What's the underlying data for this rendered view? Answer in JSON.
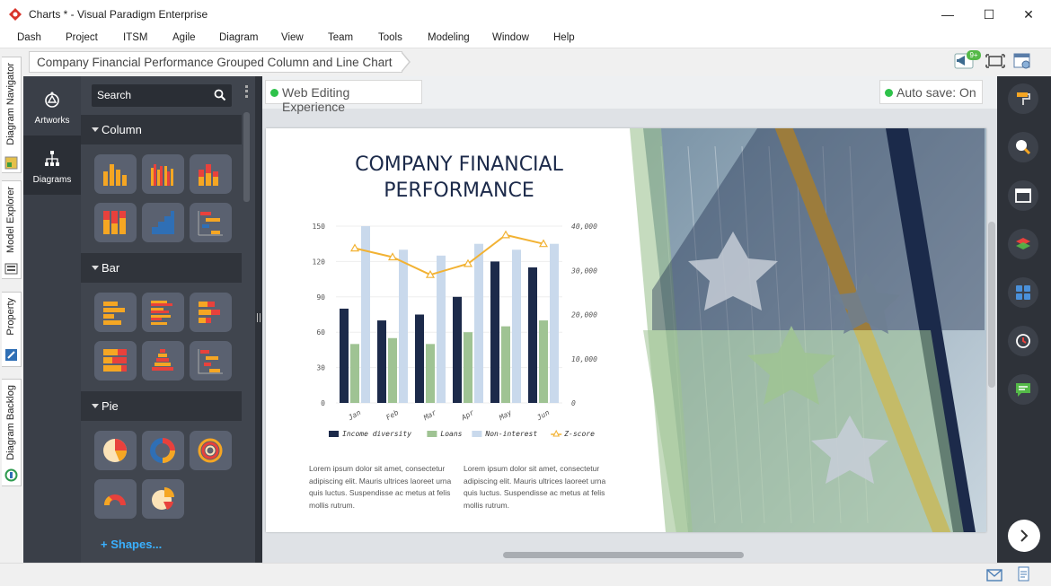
{
  "window": {
    "title": "Charts * - Visual Paradigm Enterprise",
    "minimize": "—",
    "maximize": "☐",
    "close": "✕"
  },
  "menu": [
    "Dash",
    "Project",
    "ITSM",
    "Agile",
    "Diagram",
    "View",
    "Team",
    "Tools",
    "Modeling",
    "Window",
    "Help"
  ],
  "breadcrumb": "Company Financial Performance Grouped Column and Line Chart",
  "notification_badge": "9+",
  "left_tabs": [
    "Diagram Navigator",
    "Model Explorer",
    "Property",
    "Diagram Backlog"
  ],
  "nav": {
    "artworks": "Artworks",
    "diagrams": "Diagrams"
  },
  "palette": {
    "search_placeholder": "Search",
    "sections": [
      "Column",
      "Bar",
      "Pie"
    ],
    "shapes_link": "+ Shapes..."
  },
  "canvas": {
    "web_editing": "Web Editing Experience",
    "autosave": "Auto save: On"
  },
  "slide": {
    "title_line1": "COMPANY FINANCIAL",
    "title_line2": "PERFORMANCE",
    "lorem1": "Lorem ipsum dolor sit amet, consectetur adipiscing elit. Mauris ultrices laoreet urna quis luctus. Suspendisse ac metus at felis mollis rutrum.",
    "lorem2": "Lorem ipsum dolor sit amet, consectetur adipiscing elit. Mauris ultrices laoreet urna quis luctus. Suspendisse ac metus at felis mollis rutrum."
  },
  "chart_data": {
    "type": "bar",
    "categories": [
      "Jan",
      "Feb",
      "Mar",
      "Apr",
      "May",
      "Jun"
    ],
    "series": [
      {
        "name": "Income diversity",
        "type": "bar",
        "axis": "left",
        "values": [
          80,
          70,
          75,
          90,
          120,
          115
        ],
        "color": "#1c2a4a"
      },
      {
        "name": "Loans",
        "type": "bar",
        "axis": "left",
        "values": [
          50,
          55,
          50,
          60,
          65,
          70
        ],
        "color": "#9fc393"
      },
      {
        "name": "Non-interest",
        "type": "bar",
        "axis": "left",
        "values": [
          150,
          130,
          125,
          135,
          130,
          135
        ],
        "color": "#c9d9ec"
      },
      {
        "name": "Z-score",
        "type": "line",
        "axis": "right",
        "values": [
          35000,
          33000,
          29000,
          31500,
          38000,
          36000
        ],
        "color": "#f2b233"
      }
    ],
    "yticks_left": [
      "0",
      "30",
      "60",
      "90",
      "120",
      "150"
    ],
    "yticks_right": [
      "0",
      "10,000",
      "20,000",
      "30,000",
      "40,000"
    ],
    "ylim_left": [
      0,
      150
    ],
    "ylim_right": [
      0,
      40000
    ],
    "legend_position": "bottom"
  }
}
